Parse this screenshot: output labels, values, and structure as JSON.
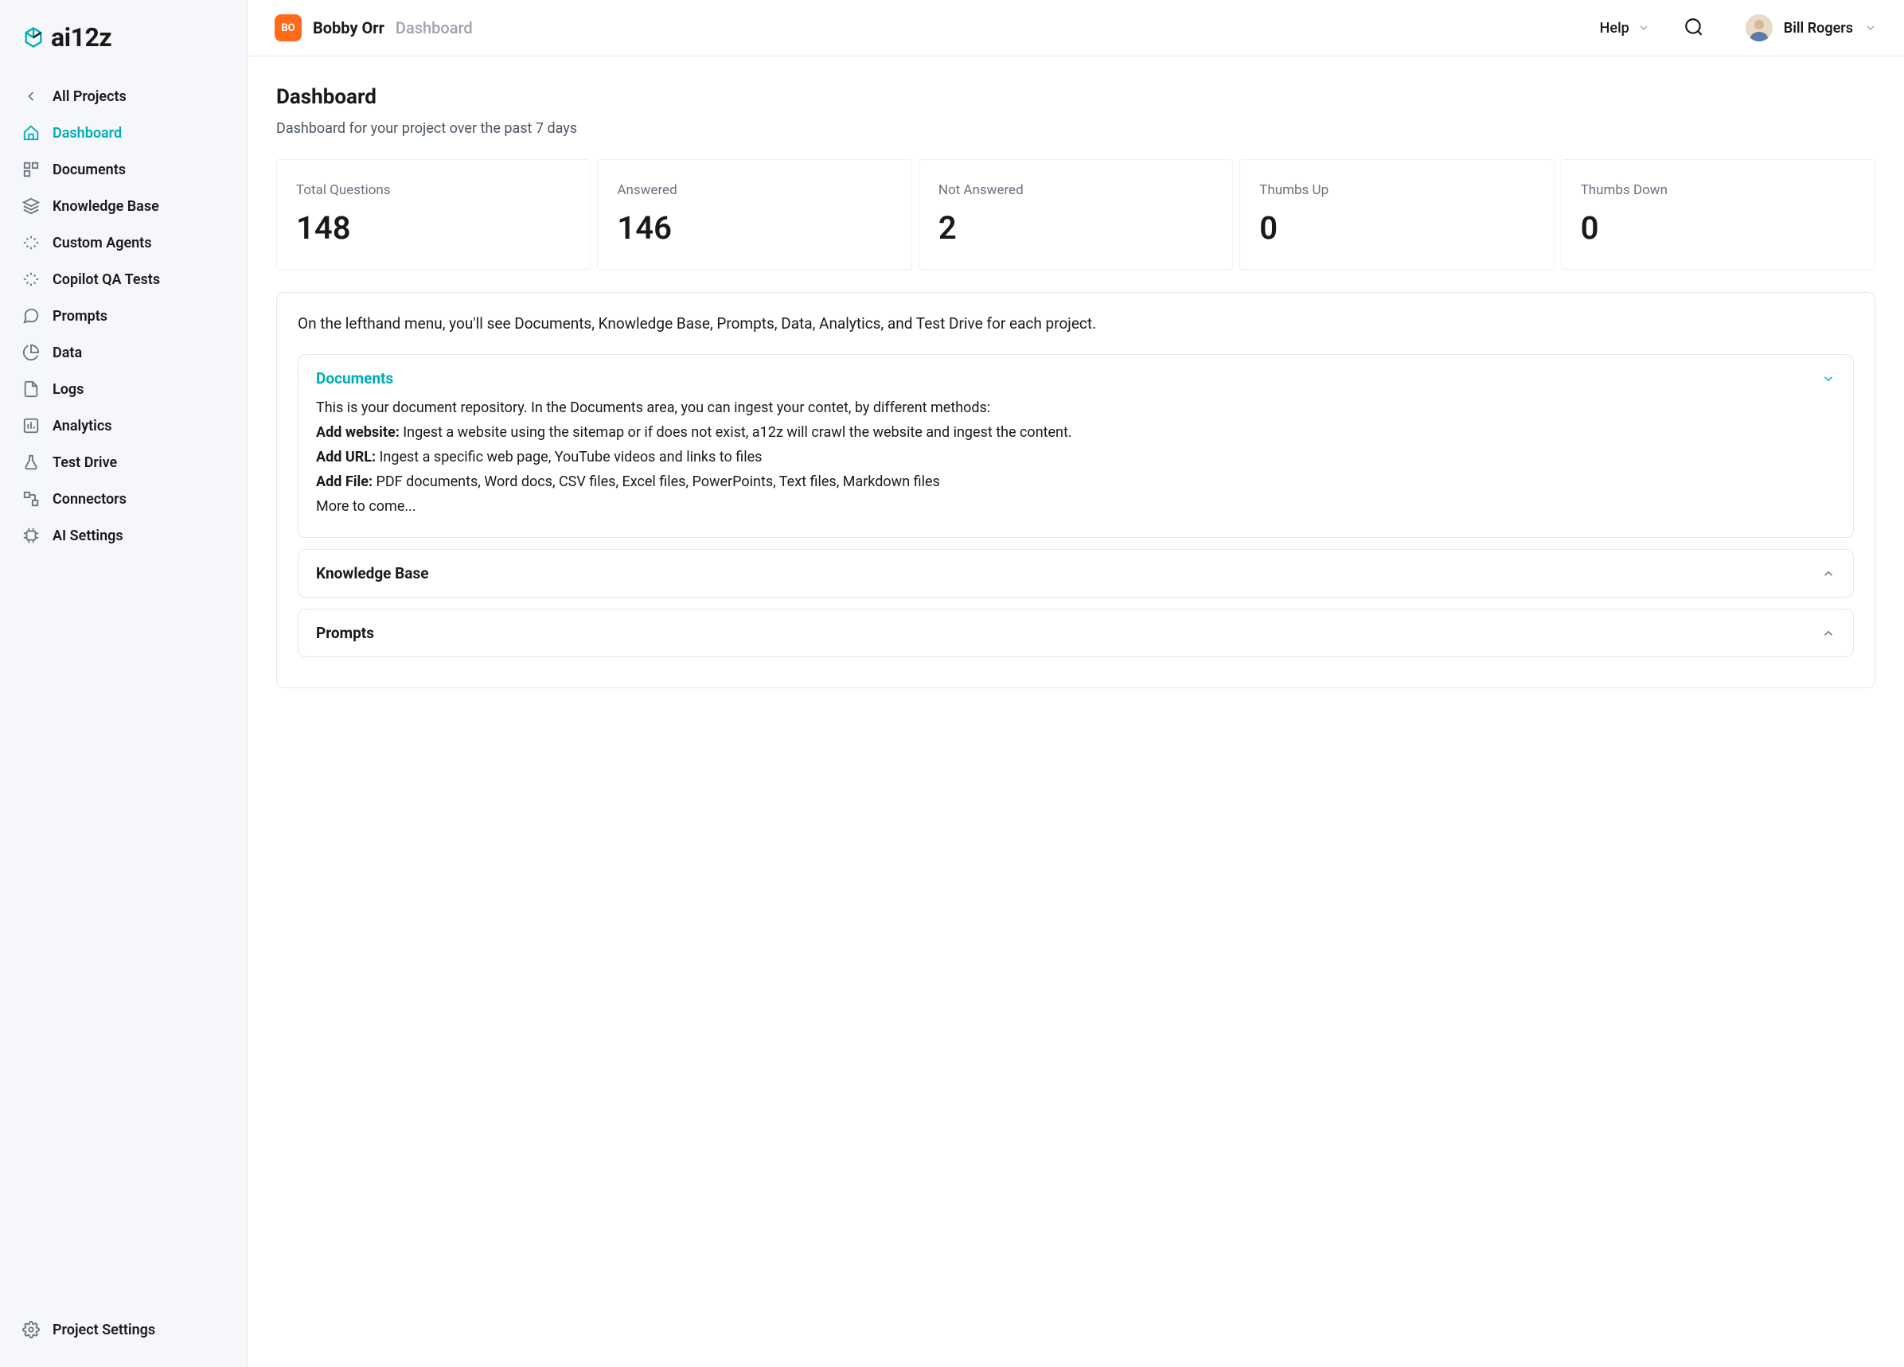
{
  "brand": {
    "name": "ai12z"
  },
  "sidebar": {
    "back_label": "All Projects",
    "items": [
      {
        "label": "Dashboard"
      },
      {
        "label": "Documents"
      },
      {
        "label": "Knowledge Base"
      },
      {
        "label": "Custom Agents"
      },
      {
        "label": "Copilot QA Tests"
      },
      {
        "label": "Prompts"
      },
      {
        "label": "Data"
      },
      {
        "label": "Logs"
      },
      {
        "label": "Analytics"
      },
      {
        "label": "Test Drive"
      },
      {
        "label": "Connectors"
      },
      {
        "label": "AI Settings"
      }
    ],
    "footer_label": "Project Settings"
  },
  "topbar": {
    "project_initials": "BO",
    "project_name": "Bobby Orr",
    "breadcrumb_current": "Dashboard",
    "help_label": "Help",
    "user_name": "Bill Rogers"
  },
  "page": {
    "title": "Dashboard",
    "subtitle": "Dashboard for your project over the past 7 days"
  },
  "stats": [
    {
      "label": "Total Questions",
      "value": "148"
    },
    {
      "label": "Answered",
      "value": "146"
    },
    {
      "label": "Not Answered",
      "value": "2"
    },
    {
      "label": "Thumbs Up",
      "value": "0"
    },
    {
      "label": "Thumbs Down",
      "value": "0"
    }
  ],
  "info": {
    "intro": "On the lefthand menu, you'll see Documents, Knowledge Base, Prompts, Data, Analytics, and Test Drive for each project.",
    "documents": {
      "title": "Documents",
      "desc": "This is your document repository. In the Documents area, you can ingest your contet, by different methods:",
      "add_website_label": "Add website:",
      "add_website_text": " Ingest a website using the sitemap or if does not exist, a12z will crawl the website and ingest the content.",
      "add_url_label": "Add URL:",
      "add_url_text": " Ingest a specific web page, YouTube videos and links to files",
      "add_file_label": "Add File:",
      "add_file_text": " PDF documents, Word docs, CSV files, Excel files, PowerPoints, Text files, Markdown files",
      "more": "More to come..."
    },
    "sections": [
      {
        "title": "Knowledge Base"
      },
      {
        "title": "Prompts"
      }
    ]
  }
}
